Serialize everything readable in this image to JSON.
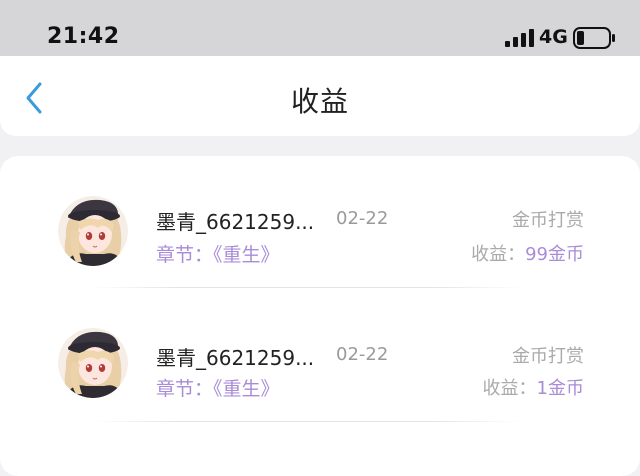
{
  "status_bar": {
    "time": "21:42",
    "network": "4G",
    "signal_icon": "signal-bars-icon",
    "battery_icon": "battery-low-icon"
  },
  "nav": {
    "title": "收益",
    "back_icon": "chevron-left-icon"
  },
  "colors": {
    "accent": "#a98bd8",
    "back_arrow": "#3a9bdc"
  },
  "items": [
    {
      "avatar": "anime-girl-avatar",
      "username": "墨青_6621259...",
      "date": "02-22",
      "chapter": "章节：《重生》",
      "type": "金币打赏",
      "earning_label": "收益：",
      "earning_amount": "99金币"
    },
    {
      "avatar": "anime-girl-avatar",
      "username": "墨青_6621259...",
      "date": "02-22",
      "chapter": "章节：《重生》",
      "type": "金币打赏",
      "earning_label": "收益：",
      "earning_amount": "1金币"
    }
  ]
}
